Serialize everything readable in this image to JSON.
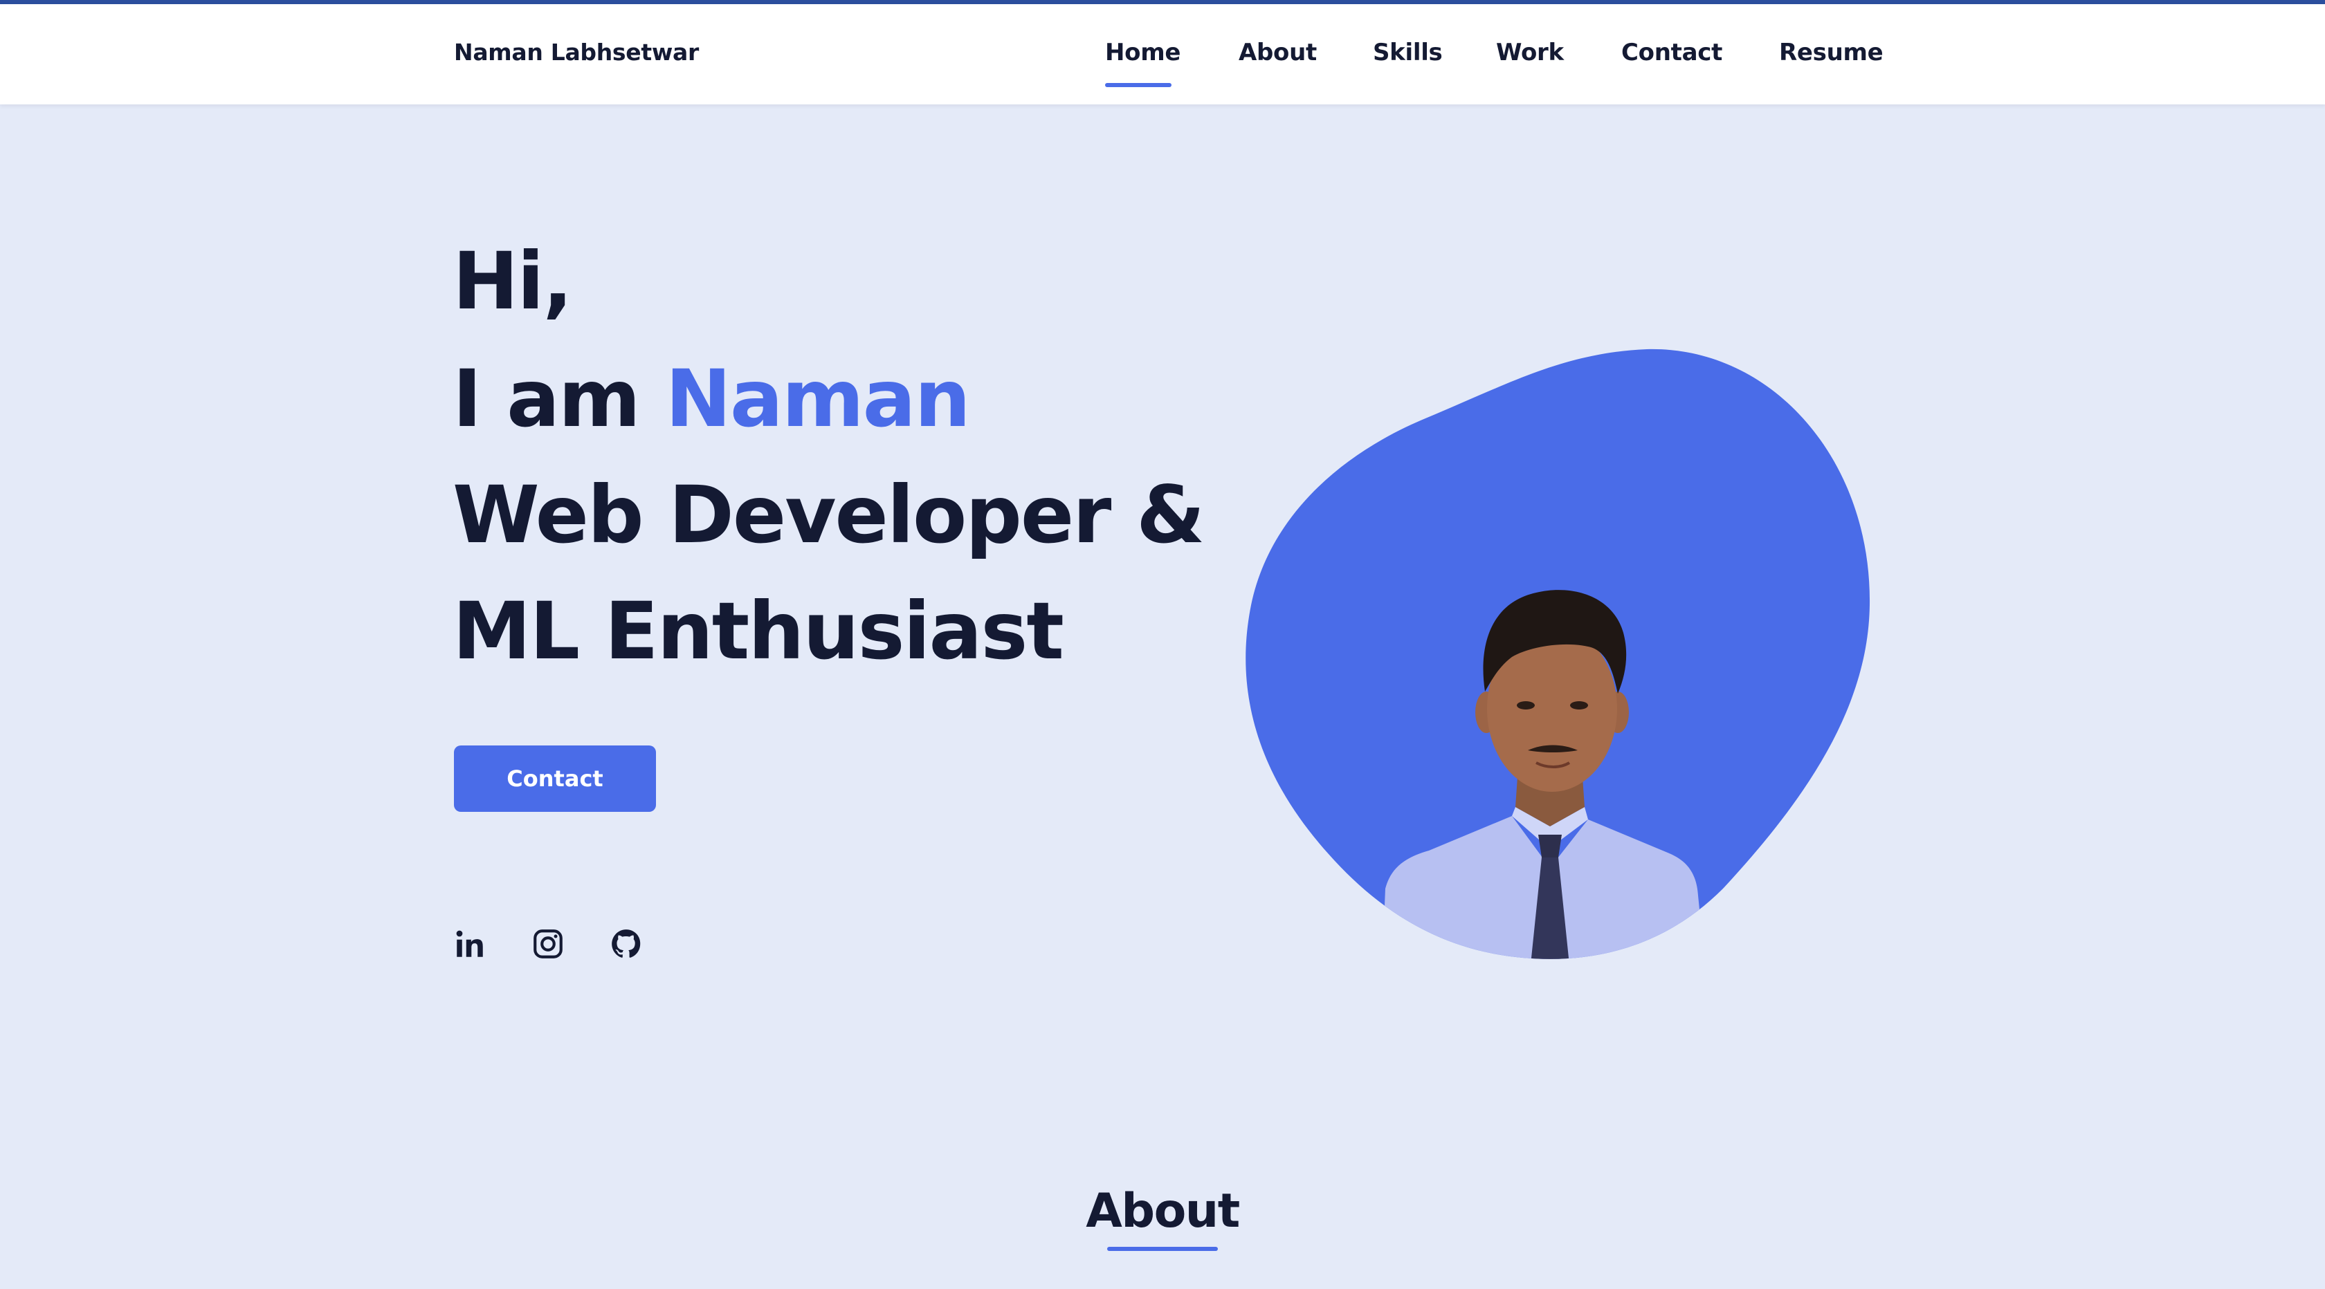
{
  "header": {
    "brand": "Naman Labhsetwar",
    "nav": [
      "Home",
      "About",
      "Skills",
      "Work",
      "Contact",
      "Resume"
    ],
    "active_nav": "Home"
  },
  "hero": {
    "greeting": "Hi,",
    "intro_prefix": "I am ",
    "name": "Naman",
    "role_line1": "Web Developer &",
    "role_line2": "ML Enthusiast",
    "contact_button": "Contact"
  },
  "social": [
    {
      "icon": "linkedin-icon"
    },
    {
      "icon": "instagram-icon"
    },
    {
      "icon": "github-icon"
    }
  ],
  "about": {
    "title": "About"
  },
  "colors": {
    "accent": "#4a6ce8",
    "background": "#e4eaf8",
    "text": "#141a33",
    "top_strip": "#2c4f9e"
  }
}
